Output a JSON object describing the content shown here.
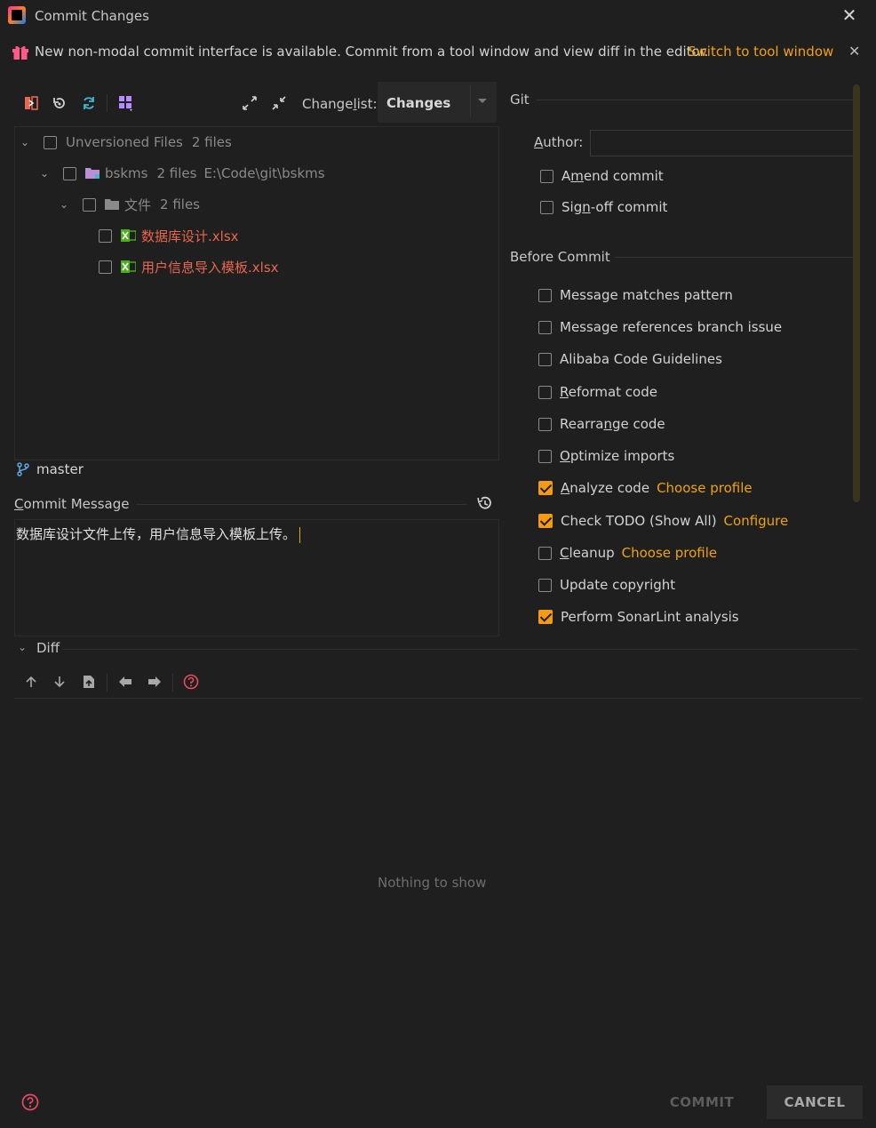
{
  "window": {
    "title": "Commit Changes"
  },
  "banner": {
    "text": "New non-modal commit interface is available. Commit from a tool window and view diff in the editor.",
    "link": "Switch to tool window"
  },
  "changelist": {
    "label_pre": "Change",
    "label_u": "l",
    "label_post": "ist:",
    "value": "Changes"
  },
  "tree": {
    "root": {
      "label": "Unversioned Files",
      "count": "2 files"
    },
    "module": {
      "label": "bskms",
      "count": "2 files",
      "path": "E:\\Code\\git\\bskms"
    },
    "folder": {
      "label": "文件",
      "count": "2 files"
    },
    "files": [
      "数据库设计.xlsx",
      "用户信息导入模板.xlsx"
    ]
  },
  "branch": "master",
  "commit_message": {
    "label_u": "C",
    "label_rest": "ommit Message",
    "text": "数据库设计文件上传，用户信息导入模板上传。"
  },
  "git": {
    "title": "Git",
    "author_u": "A",
    "author_rest": "uthor:",
    "amend_pre": "A",
    "amend_u": "m",
    "amend_post": "end commit",
    "signoff_pre": "Sig",
    "signoff_u": "n",
    "signoff_post": "-off commit"
  },
  "before_commit": {
    "title": "Before Commit",
    "message_pattern": "Message matches pattern",
    "branch_issue": "Message references branch issue",
    "alibaba": "Alibaba Code Guidelines",
    "reformat_u": "R",
    "reformat_rest": "eformat code",
    "rearrange_pre": "Rearra",
    "rearrange_u": "n",
    "rearrange_post": "ge code",
    "optimize_u": "O",
    "optimize_rest": "ptimize imports",
    "analyze_u": "A",
    "analyze_rest": "nalyze code",
    "analyze_link": "Choose profile",
    "todo": "Check TODO (Show All)",
    "todo_link": "Configure",
    "cleanup_u": "C",
    "cleanup_rest": "leanup",
    "cleanup_link": "Choose profile",
    "copyright": "Update copyright",
    "sonarlint": "Perform SonarLint analysis",
    "checked": {
      "analyze": true,
      "todo": true,
      "sonarlint": true
    }
  },
  "diff": {
    "label": "Diff",
    "empty_text": "Nothing to show"
  },
  "footer": {
    "commit": "COMMIT",
    "cancel": "CANCEL"
  },
  "colors": {
    "accent": "#f0a30a",
    "checkbox_checked": "#f49a14",
    "unversioned": "#e8674f",
    "background": "#1f1f1f"
  }
}
